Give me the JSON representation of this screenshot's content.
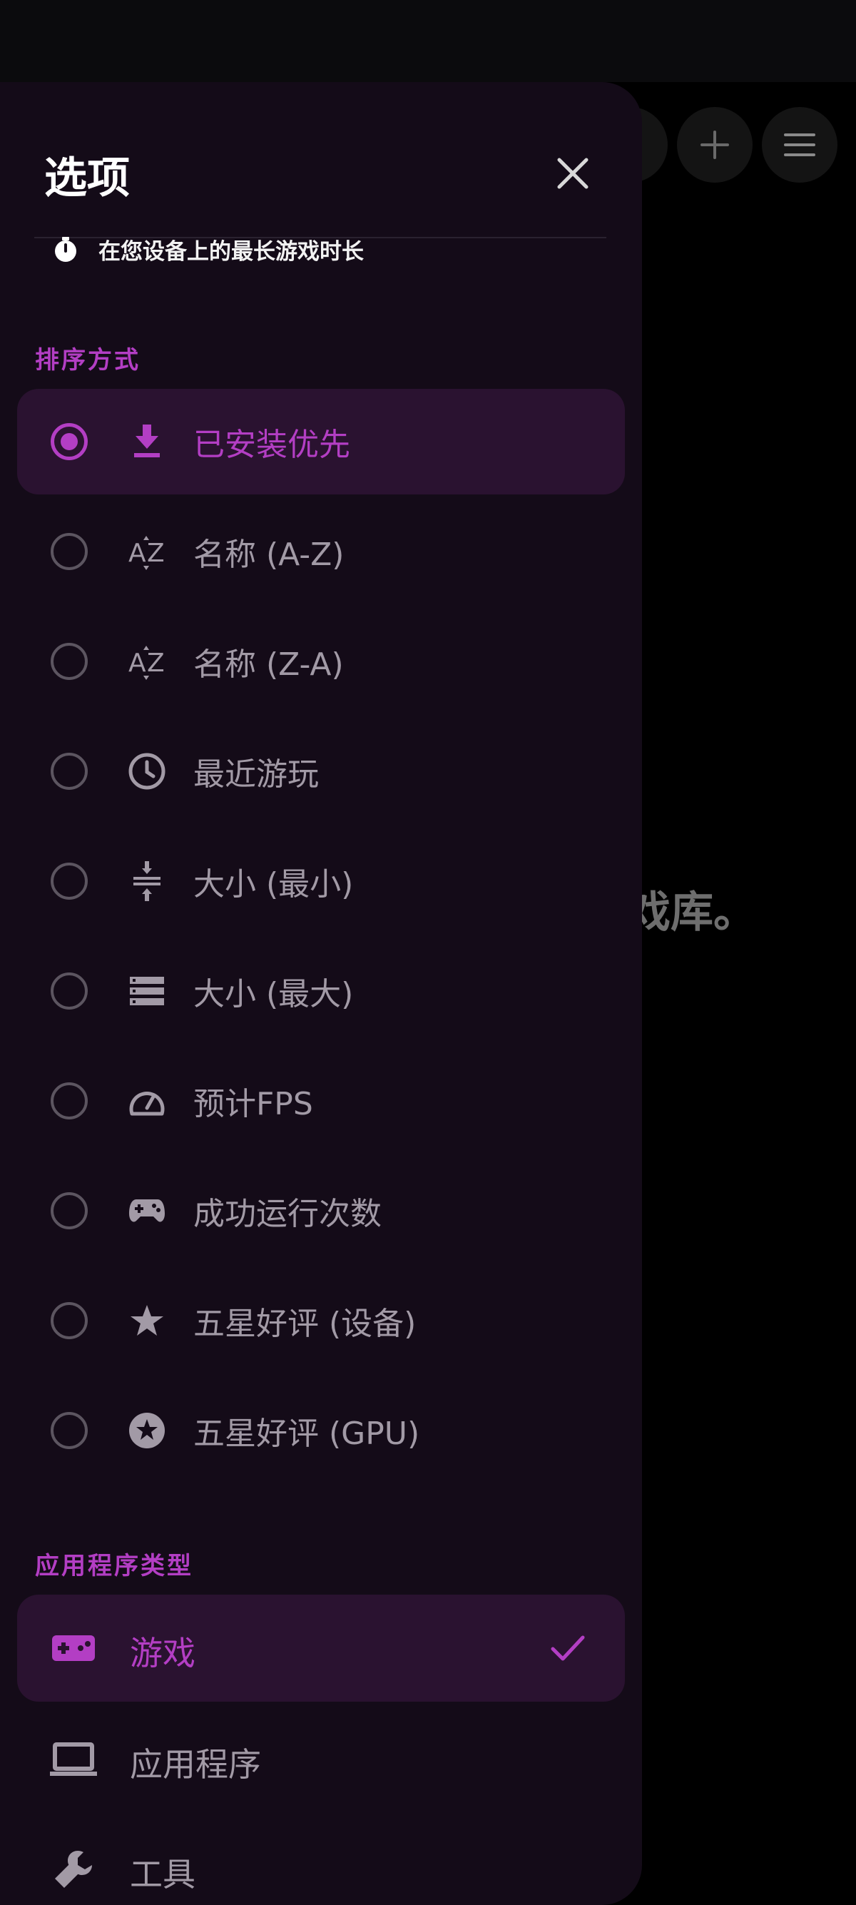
{
  "panel": {
    "title": "选项"
  },
  "playtime": {
    "text": "在您设备上的最长游戏时长"
  },
  "background": {
    "empty_text": "戏库。"
  },
  "sort": {
    "header": "排序方式",
    "items": [
      {
        "label": "已安装优先",
        "icon": "download-icon",
        "selected": true
      },
      {
        "label": "名称 (A-Z)",
        "icon": "sort-az-icon",
        "selected": false
      },
      {
        "label": "名称 (Z-A)",
        "icon": "sort-za-icon",
        "selected": false
      },
      {
        "label": "最近游玩",
        "icon": "clock-icon",
        "selected": false
      },
      {
        "label": "大小 (最小)",
        "icon": "compress-icon",
        "selected": false
      },
      {
        "label": "大小 (最大)",
        "icon": "storage-icon",
        "selected": false
      },
      {
        "label": "预计FPS",
        "icon": "speedometer-icon",
        "selected": false
      },
      {
        "label": "成功运行次数",
        "icon": "gamepad-icon",
        "selected": false
      },
      {
        "label": "五星好评 (设备)",
        "icon": "star-icon",
        "selected": false
      },
      {
        "label": "五星好评 (GPU)",
        "icon": "star-circle-icon",
        "selected": false
      }
    ]
  },
  "app_type": {
    "header": "应用程序类型",
    "items": [
      {
        "label": "游戏",
        "icon": "game-controller-icon",
        "selected": true
      },
      {
        "label": "应用程序",
        "icon": "laptop-icon",
        "selected": false
      },
      {
        "label": "工具",
        "icon": "wrench-icon",
        "selected": false
      }
    ]
  },
  "colors": {
    "accent": "#b33ec4",
    "panel_bg": "#140b18",
    "selected_bg": "#2a1230",
    "text": "#a29aa6"
  }
}
